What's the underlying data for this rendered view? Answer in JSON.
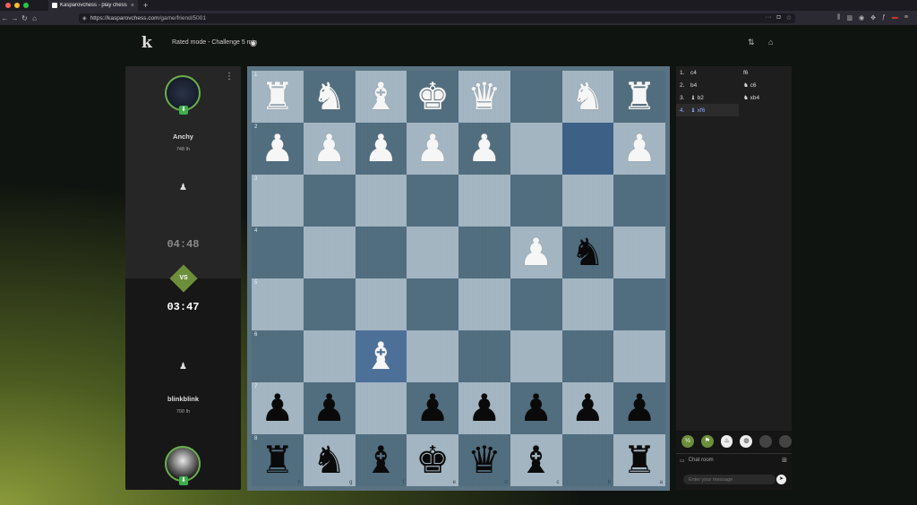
{
  "browser": {
    "tab_title": "Kasparovchess - play chess o",
    "tab_close": "×",
    "new_tab": "+",
    "url_domain": "https://kasparovchess.com",
    "url_path": "/game/friend/5001",
    "colors": {
      "close": "#ff5f57",
      "minimize": "#febc2e",
      "maximize": "#28c840"
    }
  },
  "header": {
    "logo": "k",
    "mode": "Rated mode - Challenge 5 min"
  },
  "players": {
    "top": {
      "name": "Anchy",
      "rating": "748",
      "clock": "04:48",
      "clock_color": "#8a8a8a"
    },
    "bottom": {
      "name": "blinkblink",
      "rating": "700",
      "clock": "03:47",
      "clock_color": "#ffffff"
    },
    "vs": "VS",
    "rating_icon": "Ih"
  },
  "board": {
    "rank_labels": [
      "1",
      "2",
      "3",
      "4",
      "5",
      "6",
      "7",
      "8"
    ],
    "file_labels": [
      "h",
      "g",
      "f",
      "e",
      "d",
      "c",
      "b",
      "a"
    ],
    "pieces": [
      [
        "wR",
        "wN",
        "wB",
        "wK",
        "wQ",
        "",
        "wN",
        "wR"
      ],
      [
        "wP",
        "wP",
        "wP",
        "wP",
        "wP",
        "",
        "",
        "wP"
      ],
      [
        "",
        "",
        "",
        "",
        "",
        "",
        "",
        ""
      ],
      [
        "",
        "",
        "",
        "",
        "",
        "wP",
        "bN",
        ""
      ],
      [
        "",
        "",
        "",
        "",
        "",
        "",
        "",
        ""
      ],
      [
        "",
        "",
        "wB",
        "",
        "",
        "",
        "",
        ""
      ],
      [
        "bP",
        "bP",
        "",
        "bP",
        "bP",
        "bP",
        "bP",
        "bP"
      ],
      [
        "bR",
        "bN",
        "bB",
        "bK",
        "bQ",
        "bB",
        "",
        "bR"
      ]
    ],
    "highlight_squares": [
      [
        1,
        6
      ],
      [
        5,
        2
      ]
    ]
  },
  "moves": [
    {
      "num": "1.",
      "white": "c4",
      "black": "f6"
    },
    {
      "num": "2.",
      "white": "b4",
      "black": "c6",
      "black_piece": "knight"
    },
    {
      "num": "3.",
      "white": "b2",
      "white_piece": "bishop",
      "black": "xb4",
      "black_piece": "knight"
    },
    {
      "num": "4.",
      "white": "xf6",
      "white_piece": "bishop",
      "black": ""
    }
  ],
  "chat": {
    "title": "Chat room",
    "placeholder": "Enter your message"
  }
}
